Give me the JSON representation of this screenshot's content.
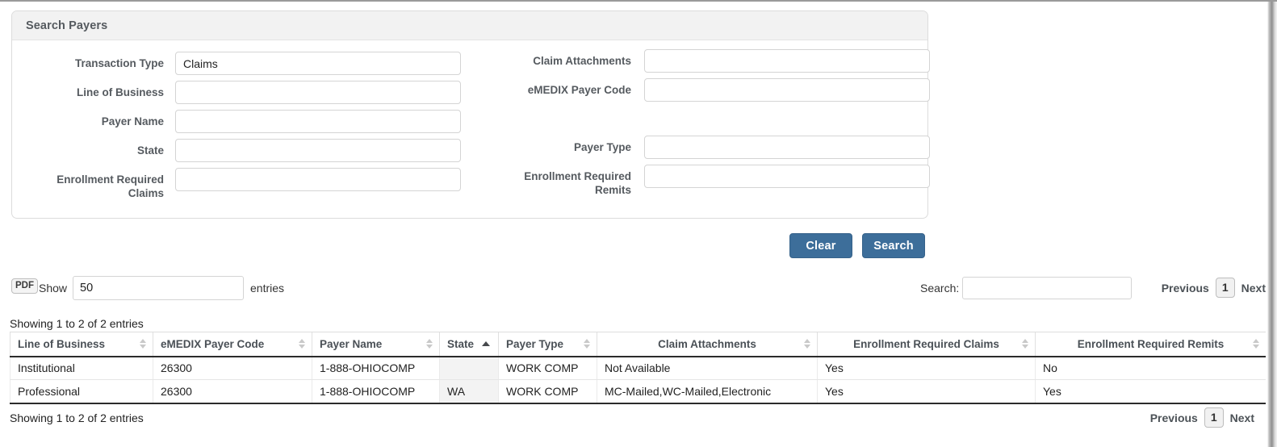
{
  "panel": {
    "title": "Search Payers",
    "left_fields": [
      {
        "label": "Transaction Type",
        "value": "Claims",
        "placeholder": "",
        "name": "transaction-type"
      },
      {
        "label": "Line of Business",
        "value": "",
        "placeholder": "",
        "name": "line-of-business"
      },
      {
        "label": "Payer Name",
        "value": "",
        "placeholder": "",
        "name": "payer-name"
      },
      {
        "label": "State",
        "value": "",
        "placeholder": "",
        "name": "state"
      },
      {
        "label": "Enrollment Required Claims",
        "value": "",
        "placeholder": "",
        "name": "enrollment-required-claims"
      }
    ],
    "right_fields": [
      {
        "label": "Claim Attachments",
        "value": "",
        "placeholder": "",
        "name": "claim-attachments"
      },
      {
        "label": "eMEDIX Payer Code",
        "value": "",
        "placeholder": "",
        "name": "emedix-payer-code"
      },
      {
        "label": "Payer Type",
        "value": "",
        "placeholder": "",
        "name": "payer-type"
      },
      {
        "label": "Enrollment Required Remits",
        "value": "",
        "placeholder": "",
        "name": "enrollment-required-remits"
      }
    ]
  },
  "actions": {
    "clear_label": "Clear",
    "search_label": "Search",
    "button_color": "#3d6e9a"
  },
  "table_controls": {
    "pdf_label": "PDF",
    "show_label": "Show",
    "length_value": "50",
    "length_placeholder": "",
    "entries_label": "entries",
    "search_label": "Search:",
    "search_value": "",
    "search_placeholder": ""
  },
  "pagination": {
    "previous_label": "Previous",
    "page_label": "1",
    "next_label": "Next"
  },
  "table": {
    "info_top": "Showing 1 to 2 of 2 entries",
    "info_bottom": "Showing 1 to 2 of 2 entries",
    "sorted_column": "State",
    "sort_direction": "asc",
    "columns": [
      {
        "label": "Line of Business",
        "align": "left"
      },
      {
        "label": "eMEDIX Payer Code",
        "align": "left"
      },
      {
        "label": "Payer Name",
        "align": "left"
      },
      {
        "label": "State",
        "align": "left"
      },
      {
        "label": "Payer Type",
        "align": "left"
      },
      {
        "label": "Claim Attachments",
        "align": "center"
      },
      {
        "label": "Enrollment Required Claims",
        "align": "center"
      },
      {
        "label": "Enrollment Required Remits",
        "align": "center"
      }
    ],
    "rows": [
      {
        "line_of_business": "Institutional",
        "emedix_payer_code": "26300",
        "payer_name": "1-888-OHIOCOMP",
        "state": "",
        "payer_type": "WORK COMP",
        "claim_attachments": "Not Available",
        "enrollment_required_claims": "Yes",
        "enrollment_required_remits": "No"
      },
      {
        "line_of_business": "Professional",
        "emedix_payer_code": "26300",
        "payer_name": "1-888-OHIOCOMP",
        "state": "WA",
        "payer_type": "WORK COMP",
        "claim_attachments": "MC-Mailed,WC-Mailed,Electronic",
        "enrollment_required_claims": "Yes",
        "enrollment_required_remits": "Yes"
      }
    ]
  }
}
